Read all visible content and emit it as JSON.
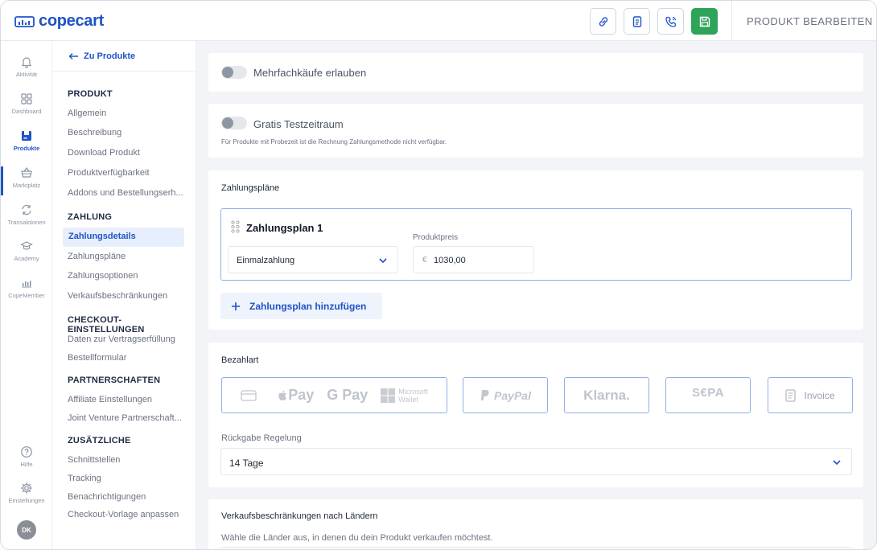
{
  "app": {
    "logo_text": "copecart",
    "page_title": "PRODUKT BEARBEITEN"
  },
  "rail": [
    {
      "label": "Aktivität",
      "icon": "bell-icon"
    },
    {
      "label": "Dashboard",
      "icon": "dashboard-icon"
    },
    {
      "label": "Produkte",
      "icon": "box-icon",
      "active": true
    },
    {
      "label": "Marktplatz",
      "icon": "basket-icon"
    },
    {
      "label": "Transaktionen",
      "icon": "transactions-icon"
    },
    {
      "label": "Academy",
      "icon": "graduation-cap-icon"
    },
    {
      "label": "CopeMember",
      "icon": "members-icon"
    },
    {
      "label": "Hilfe",
      "icon": "help-icon"
    },
    {
      "label": "Einstellungen",
      "icon": "gear-icon"
    },
    {
      "label": "DK",
      "icon": "avatar"
    }
  ],
  "nav": {
    "back": "Zu Produkte",
    "sections": [
      {
        "title": "PRODUKT",
        "items": [
          "Allgemein",
          "Beschreibung",
          "Download Produkt",
          "Produktverfügbarkeit",
          "Addons und Bestellungserh..."
        ]
      },
      {
        "title": "ZAHLUNG",
        "items": [
          "Zahlungsdetails",
          "Zahlungspläne",
          "Zahlungsoptionen",
          "Verkaufsbeschränkungen"
        ]
      },
      {
        "title": "CHECKOUT-EINSTELLUNGEN",
        "items": [
          "Daten zur Vertragserfüllung",
          "Bestellformular"
        ]
      },
      {
        "title": "PARTNERSCHAFTEN",
        "items": [
          "Affiliate Einstellungen",
          "Joint Venture Partnerschaft..."
        ]
      },
      {
        "title": "ZUSÄTZLICHE",
        "items": [
          "Schnittstellen",
          "Tracking",
          "Benachrichtigungen",
          "Checkout-Vorlage anpassen"
        ]
      }
    ],
    "active_item": "Zahlungsdetails"
  },
  "main": {
    "multi_purchase": {
      "label": "Mehrfachkäufe erlauben",
      "enabled": false
    },
    "trial": {
      "label": "Gratis Testzeitraum",
      "enabled": false,
      "hint": "Für Produkte mit Probezeit ist die Rechnung Zahlungsmethode nicht verfügbar."
    },
    "plans": {
      "title": "Zahlungspläne",
      "plan_name": "Zahlungsplan 1",
      "type_value": "Einmalzahlung",
      "price_label": "Produktpreis",
      "currency": "€",
      "price_value": "1030,00",
      "add_button": "Zahlungsplan hinzufügen"
    },
    "payment": {
      "title": "Bezahlart",
      "methods": [
        "Pay",
        "G Pay",
        "Microsoft",
        "Wallet",
        "PayPal",
        "Klarna.",
        "S€PA",
        "Invoice"
      ],
      "return_label": "Rückgabe Regelung",
      "return_value": "14 Tage"
    },
    "country": {
      "title": "Verkaufsbeschränkungen nach Ländern",
      "hint": "Wähle die Länder aus, in denen du dein Produkt verkaufen möchtest."
    }
  },
  "colors": {
    "accent": "#1f53c7",
    "save": "#2ea45a",
    "active_bg": "#e8effc"
  }
}
